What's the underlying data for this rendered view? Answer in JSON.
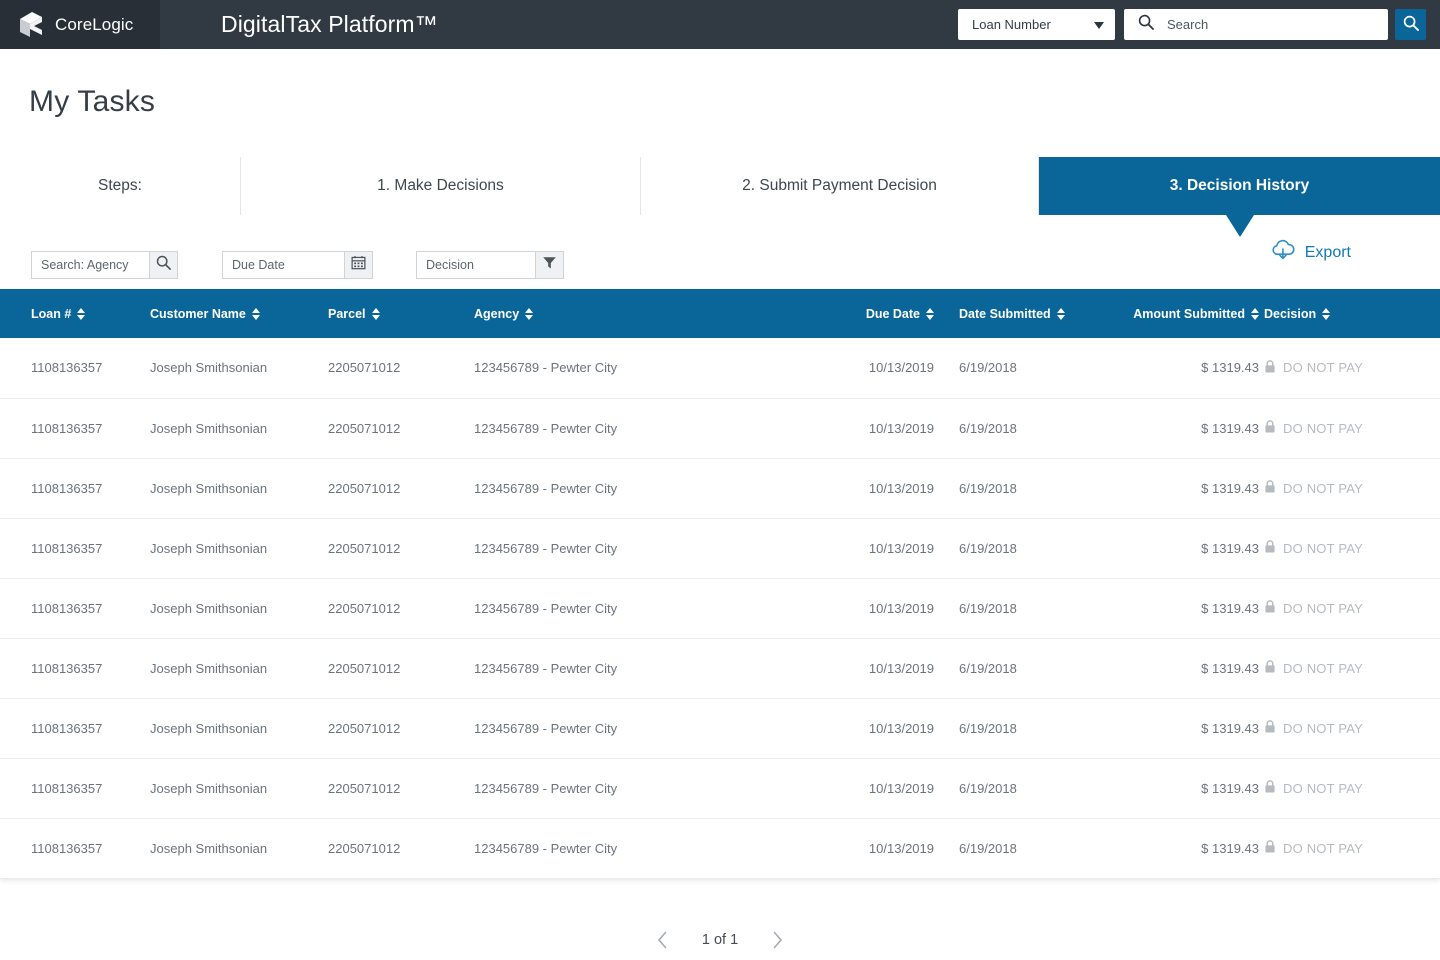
{
  "header": {
    "brand": "CoreLogic",
    "logo_icon": "corelogic-cube-icon",
    "app_title": "DigitalTax Platform™",
    "loan_select_value": "Loan Number",
    "loan_select_icon": "chevron-down-icon",
    "search_placeholder": "Search",
    "search_value": "",
    "search_icon": "search-icon",
    "search_button_icon": "search-icon",
    "bar_color": "#313a43",
    "brand_block_color": "#282f36"
  },
  "page": {
    "title": "My Tasks",
    "accent_color": "#0a6699"
  },
  "tabs": [
    {
      "label": "Steps:",
      "active": false
    },
    {
      "label": "1.  Make Decisions",
      "active": false
    },
    {
      "label": "2. Submit Payment Decision",
      "active": false
    },
    {
      "label": "3. Decision History",
      "active": true
    }
  ],
  "filters": {
    "agency": {
      "placeholder": "Search: Agency",
      "value": "",
      "icon": "search-icon"
    },
    "due_date": {
      "placeholder": "Due Date",
      "value": "",
      "icon": "calendar-icon"
    },
    "decision": {
      "placeholder": "Decision",
      "value": "",
      "icon": "filter-funnel-icon"
    },
    "export": {
      "label": "Export",
      "icon": "cloud-download-icon",
      "color": "#0f7ab0"
    }
  },
  "table": {
    "columns": [
      {
        "label": "Loan #",
        "sortable": true
      },
      {
        "label": "Customer Name",
        "sortable": true
      },
      {
        "label": "Parcel",
        "sortable": true
      },
      {
        "label": "Agency",
        "sortable": true
      },
      {
        "label": "Due Date",
        "sortable": true
      },
      {
        "label": "Date Submitted",
        "sortable": true
      },
      {
        "label": "Amount Submitted",
        "sortable": true
      },
      {
        "label": "Decision",
        "sortable": true
      }
    ],
    "rows": [
      {
        "loan": "1108136357",
        "customer": "Joseph Smithsonian",
        "parcel": "2205071012",
        "agency": "123456789 - Pewter City",
        "due_date": "10/13/2019",
        "date_submitted": "6/19/2018",
        "amount": "$ 1319.43",
        "decision": "DO NOT PAY",
        "decision_icon": "lock-icon"
      },
      {
        "loan": "1108136357",
        "customer": "Joseph Smithsonian",
        "parcel": "2205071012",
        "agency": "123456789 - Pewter City",
        "due_date": "10/13/2019",
        "date_submitted": "6/19/2018",
        "amount": "$ 1319.43",
        "decision": "DO NOT PAY",
        "decision_icon": "lock-icon"
      },
      {
        "loan": "1108136357",
        "customer": "Joseph Smithsonian",
        "parcel": "2205071012",
        "agency": "123456789 - Pewter City",
        "due_date": "10/13/2019",
        "date_submitted": "6/19/2018",
        "amount": "$ 1319.43",
        "decision": "DO NOT PAY",
        "decision_icon": "lock-icon"
      },
      {
        "loan": "1108136357",
        "customer": "Joseph Smithsonian",
        "parcel": "2205071012",
        "agency": "123456789 - Pewter City",
        "due_date": "10/13/2019",
        "date_submitted": "6/19/2018",
        "amount": "$ 1319.43",
        "decision": "DO NOT PAY",
        "decision_icon": "lock-icon"
      },
      {
        "loan": "1108136357",
        "customer": "Joseph Smithsonian",
        "parcel": "2205071012",
        "agency": "123456789 - Pewter City",
        "due_date": "10/13/2019",
        "date_submitted": "6/19/2018",
        "amount": "$ 1319.43",
        "decision": "DO NOT PAY",
        "decision_icon": "lock-icon"
      },
      {
        "loan": "1108136357",
        "customer": "Joseph Smithsonian",
        "parcel": "2205071012",
        "agency": "123456789 - Pewter City",
        "due_date": "10/13/2019",
        "date_submitted": "6/19/2018",
        "amount": "$ 1319.43",
        "decision": "DO NOT PAY",
        "decision_icon": "lock-icon"
      },
      {
        "loan": "1108136357",
        "customer": "Joseph Smithsonian",
        "parcel": "2205071012",
        "agency": "123456789 - Pewter City",
        "due_date": "10/13/2019",
        "date_submitted": "6/19/2018",
        "amount": "$ 1319.43",
        "decision": "DO NOT PAY",
        "decision_icon": "lock-icon"
      },
      {
        "loan": "1108136357",
        "customer": "Joseph Smithsonian",
        "parcel": "2205071012",
        "agency": "123456789 - Pewter City",
        "due_date": "10/13/2019",
        "date_submitted": "6/19/2018",
        "amount": "$ 1319.43",
        "decision": "DO NOT PAY",
        "decision_icon": "lock-icon"
      },
      {
        "loan": "1108136357",
        "customer": "Joseph Smithsonian",
        "parcel": "2205071012",
        "agency": "123456789 - Pewter City",
        "due_date": "10/13/2019",
        "date_submitted": "6/19/2018",
        "amount": "$ 1319.43",
        "decision": "DO NOT PAY",
        "decision_icon": "lock-icon"
      }
    ]
  },
  "pagination": {
    "prev_icon": "chevron-left-icon",
    "next_icon": "chevron-right-icon",
    "label": "1 of 1"
  }
}
